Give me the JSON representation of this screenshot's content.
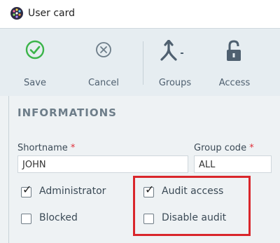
{
  "window": {
    "title": "User card",
    "app_icon": "dotted-globe-icon"
  },
  "toolbar": {
    "save": {
      "label": "Save",
      "icon": "check-circle-icon",
      "color": "#3bb44a"
    },
    "cancel": {
      "label": "Cancel",
      "icon": "x-circle-icon",
      "color": "#6d7d89"
    },
    "groups": {
      "label": "Groups",
      "icon": "merge-arrow-icon"
    },
    "access": {
      "label": "Access",
      "icon": "unlock-icon"
    }
  },
  "section": {
    "title": "INFORMATIONS"
  },
  "fields": {
    "shortname": {
      "label": "Shortname",
      "required_mark": "*",
      "value": "JOHN"
    },
    "group_code": {
      "label": "Group code",
      "required_mark": "*",
      "value": "ALL"
    }
  },
  "checkboxes": {
    "administrator": {
      "label": "Administrator",
      "checked": true
    },
    "blocked": {
      "label": "Blocked",
      "checked": false
    },
    "audit_access": {
      "label": "Audit access",
      "checked": true
    },
    "disable_audit": {
      "label": "Disable audit",
      "checked": false
    }
  },
  "colors": {
    "toolbar_bg": "#e6edf1",
    "panel_bg": "#eef2f4",
    "highlight": "#d9262b",
    "required": "#e0303a"
  }
}
